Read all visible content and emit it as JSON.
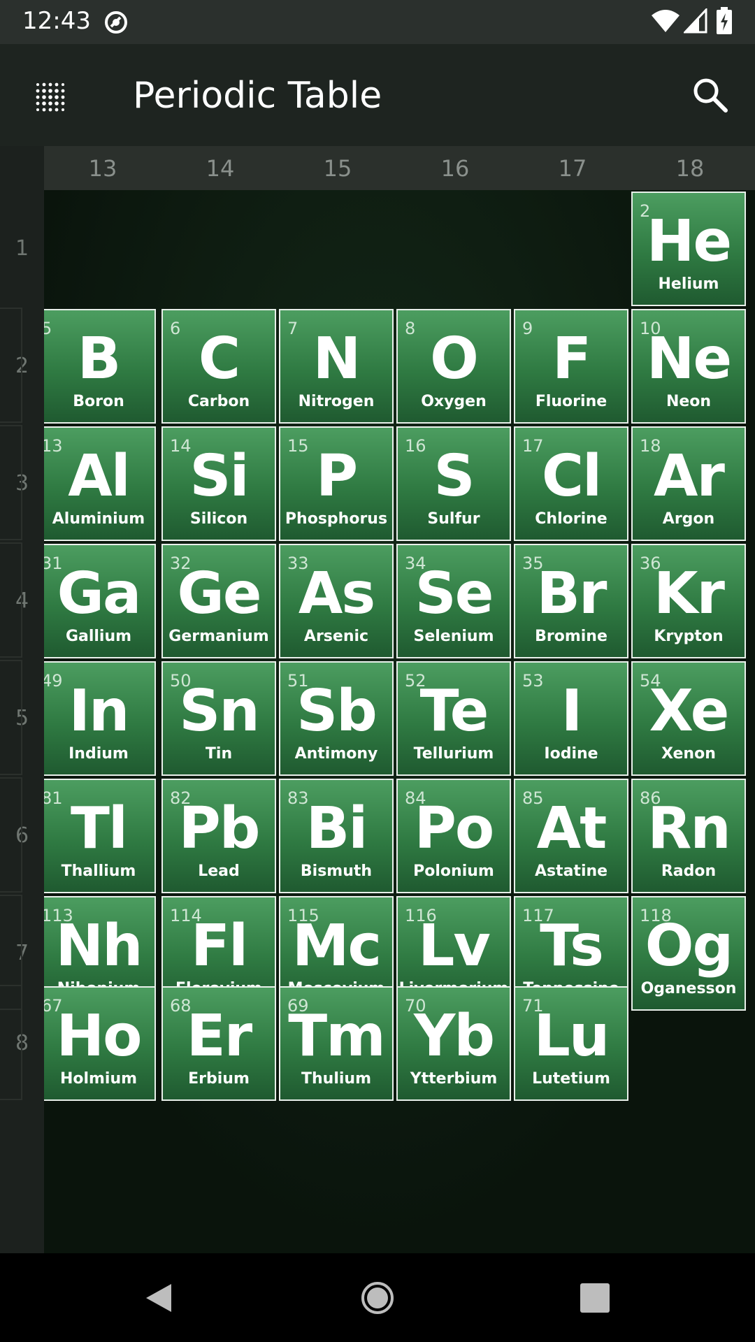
{
  "status_bar": {
    "time": "12:43"
  },
  "app_bar": {
    "title": "Periodic Table"
  },
  "groups": [
    "13",
    "14",
    "15",
    "16",
    "17",
    "18"
  ],
  "periods": [
    "1",
    "2",
    "3",
    "4",
    "5",
    "6",
    "7",
    "8"
  ],
  "elements": [
    {
      "number": "2",
      "symbol": "He",
      "name": "Helium",
      "row": 0,
      "col": 5
    },
    {
      "number": "5",
      "symbol": "B",
      "name": "Boron",
      "row": 1,
      "col": 0
    },
    {
      "number": "6",
      "symbol": "C",
      "name": "Carbon",
      "row": 1,
      "col": 1
    },
    {
      "number": "7",
      "symbol": "N",
      "name": "Nitrogen",
      "row": 1,
      "col": 2
    },
    {
      "number": "8",
      "symbol": "O",
      "name": "Oxygen",
      "row": 1,
      "col": 3
    },
    {
      "number": "9",
      "symbol": "F",
      "name": "Fluorine",
      "row": 1,
      "col": 4
    },
    {
      "number": "10",
      "symbol": "Ne",
      "name": "Neon",
      "row": 1,
      "col": 5
    },
    {
      "number": "13",
      "symbol": "Al",
      "name": "Aluminium",
      "row": 2,
      "col": 0
    },
    {
      "number": "14",
      "symbol": "Si",
      "name": "Silicon",
      "row": 2,
      "col": 1
    },
    {
      "number": "15",
      "symbol": "P",
      "name": "Phosphorus",
      "row": 2,
      "col": 2
    },
    {
      "number": "16",
      "symbol": "S",
      "name": "Sulfur",
      "row": 2,
      "col": 3
    },
    {
      "number": "17",
      "symbol": "Cl",
      "name": "Chlorine",
      "row": 2,
      "col": 4
    },
    {
      "number": "18",
      "symbol": "Ar",
      "name": "Argon",
      "row": 2,
      "col": 5
    },
    {
      "number": "31",
      "symbol": "Ga",
      "name": "Gallium",
      "row": 3,
      "col": 0
    },
    {
      "number": "32",
      "symbol": "Ge",
      "name": "Germanium",
      "row": 3,
      "col": 1
    },
    {
      "number": "33",
      "symbol": "As",
      "name": "Arsenic",
      "row": 3,
      "col": 2
    },
    {
      "number": "34",
      "symbol": "Se",
      "name": "Selenium",
      "row": 3,
      "col": 3
    },
    {
      "number": "35",
      "symbol": "Br",
      "name": "Bromine",
      "row": 3,
      "col": 4
    },
    {
      "number": "36",
      "symbol": "Kr",
      "name": "Krypton",
      "row": 3,
      "col": 5
    },
    {
      "number": "49",
      "symbol": "In",
      "name": "Indium",
      "row": 4,
      "col": 0
    },
    {
      "number": "50",
      "symbol": "Sn",
      "name": "Tin",
      "row": 4,
      "col": 1
    },
    {
      "number": "51",
      "symbol": "Sb",
      "name": "Antimony",
      "row": 4,
      "col": 2
    },
    {
      "number": "52",
      "symbol": "Te",
      "name": "Tellurium",
      "row": 4,
      "col": 3
    },
    {
      "number": "53",
      "symbol": "I",
      "name": "Iodine",
      "row": 4,
      "col": 4
    },
    {
      "number": "54",
      "symbol": "Xe",
      "name": "Xenon",
      "row": 4,
      "col": 5
    },
    {
      "number": "81",
      "symbol": "Tl",
      "name": "Thallium",
      "row": 5,
      "col": 0
    },
    {
      "number": "82",
      "symbol": "Pb",
      "name": "Lead",
      "row": 5,
      "col": 1
    },
    {
      "number": "83",
      "symbol": "Bi",
      "name": "Bismuth",
      "row": 5,
      "col": 2
    },
    {
      "number": "84",
      "symbol": "Po",
      "name": "Polonium",
      "row": 5,
      "col": 3
    },
    {
      "number": "85",
      "symbol": "At",
      "name": "Astatine",
      "row": 5,
      "col": 4
    },
    {
      "number": "86",
      "symbol": "Rn",
      "name": "Radon",
      "row": 5,
      "col": 5
    },
    {
      "number": "113",
      "symbol": "Nh",
      "name": "Nihonium",
      "row": 6,
      "col": 0
    },
    {
      "number": "114",
      "symbol": "Fl",
      "name": "Flerovium",
      "row": 6,
      "col": 1
    },
    {
      "number": "115",
      "symbol": "Mc",
      "name": "Moscovium",
      "row": 6,
      "col": 2
    },
    {
      "number": "116",
      "symbol": "Lv",
      "name": "Livermorium",
      "row": 6,
      "col": 3
    },
    {
      "number": "117",
      "symbol": "Ts",
      "name": "Tennessine",
      "row": 6,
      "col": 4
    },
    {
      "number": "118",
      "symbol": "Og",
      "name": "Oganesson",
      "row": 6,
      "col": 5
    },
    {
      "number": "67",
      "symbol": "Ho",
      "name": "Holmium",
      "row": 8,
      "col": 0
    },
    {
      "number": "68",
      "symbol": "Er",
      "name": "Erbium",
      "row": 8,
      "col": 1
    },
    {
      "number": "69",
      "symbol": "Tm",
      "name": "Thulium",
      "row": 8,
      "col": 2
    },
    {
      "number": "70",
      "symbol": "Yb",
      "name": "Ytterbium",
      "row": 8,
      "col": 3
    },
    {
      "number": "71",
      "symbol": "Lu",
      "name": "Lutetium",
      "row": 8,
      "col": 4
    }
  ],
  "colors": {
    "tile": "#3a8a50",
    "tile_border": "#e8f0ea",
    "app_bar": "#1e2420"
  }
}
